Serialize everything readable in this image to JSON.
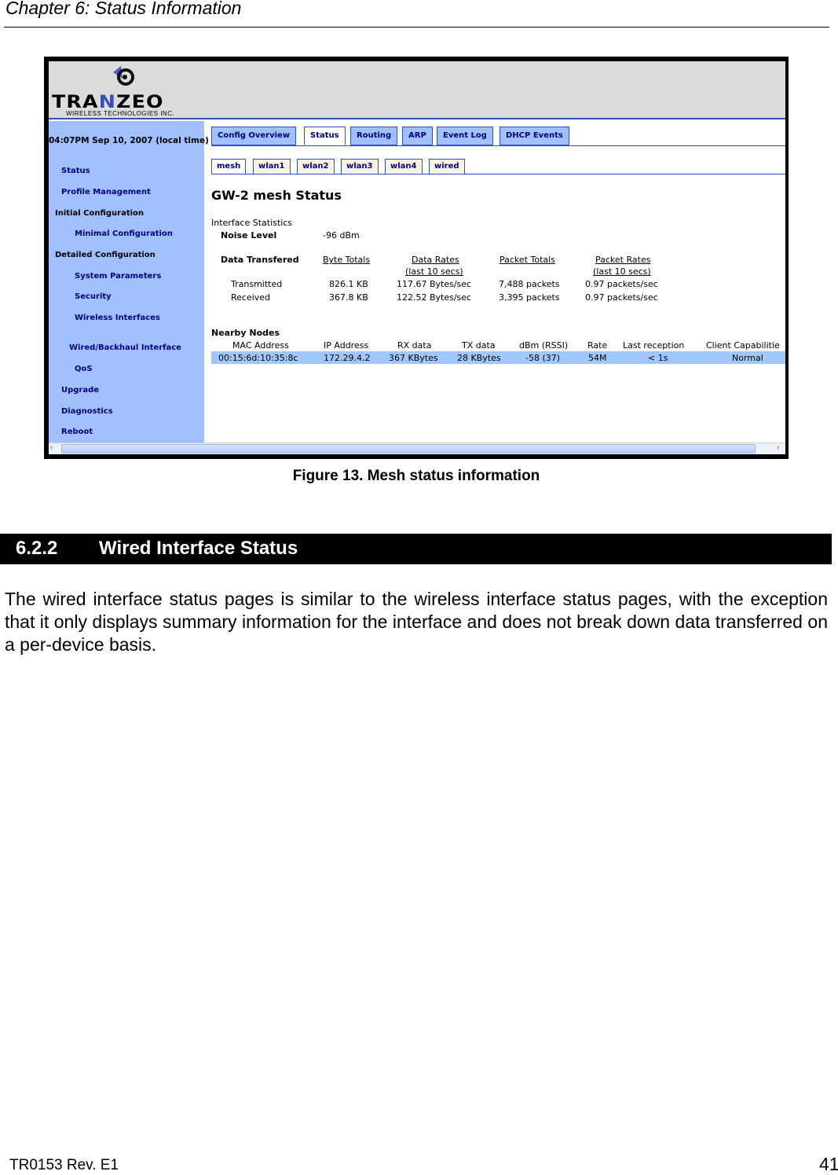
{
  "header": {
    "chapter": "Chapter 6: Status Information"
  },
  "screenshot": {
    "logo": {
      "brand": "TRANZEO",
      "sub": "WIRELESS TECHNOLOGIES INC."
    },
    "sidebar": {
      "time": "04:07PM Sep 10, 2007 (local time)",
      "items": [
        "Status",
        "Profile Management",
        "Initial Configuration",
        "Minimal Configuration",
        "Detailed Configuration",
        "System Parameters",
        "Security",
        "Wireless Interfaces",
        "Wired/Backhaul Interface",
        "QoS",
        "Upgrade",
        "Diagnostics",
        "Reboot"
      ]
    },
    "tabs": [
      "Config Overview",
      "Status",
      "Routing",
      "ARP",
      "Event Log",
      "DHCP Events"
    ],
    "subtabs": [
      "mesh",
      "wlan1",
      "wlan2",
      "wlan3",
      "wlan4",
      "wired"
    ],
    "title": "GW-2 mesh Status",
    "iface": {
      "heading": "Interface Statistics",
      "noise_label": "Noise Level",
      "noise_value": "-96 dBm"
    },
    "transfer": {
      "heading": "Data Transfered",
      "cols": [
        "Byte Totals",
        "Data Rates",
        "(last 10 secs)",
        "Packet Totals",
        "Packet Rates",
        "(last 10 secs)"
      ],
      "rows": [
        [
          "Transmitted",
          "826.1 KB",
          "117.67 Bytes/sec",
          "7,488 packets",
          "0.97 packets/sec"
        ],
        [
          "Received",
          "367.8 KB",
          "122.52 Bytes/sec",
          "3,395 packets",
          "0.97 packets/sec"
        ]
      ]
    },
    "nodes": {
      "heading": "Nearby Nodes",
      "cols": [
        "MAC Address",
        "IP Address",
        "RX data",
        "TX data",
        "dBm (RSSI)",
        "Rate",
        "Last reception",
        "Client Capabilitie"
      ],
      "row": [
        "00:15:6d:10:35:8c",
        "172.29.4.2",
        "367 KBytes",
        "28 KBytes",
        "-58 (37)",
        "54M",
        "< 1s",
        "Normal"
      ]
    }
  },
  "figure_caption": "Figure 13. Mesh status information",
  "section": {
    "number": "6.2.2",
    "title": "Wired Interface Status"
  },
  "paragraph": "The wired interface status pages is similar to the wireless interface status pages, with the exception that it only displays summary information for the interface and does not break down data transferred on a per-device basis.",
  "footer": {
    "doc": "TR0153 Rev. E1",
    "page": "41"
  }
}
